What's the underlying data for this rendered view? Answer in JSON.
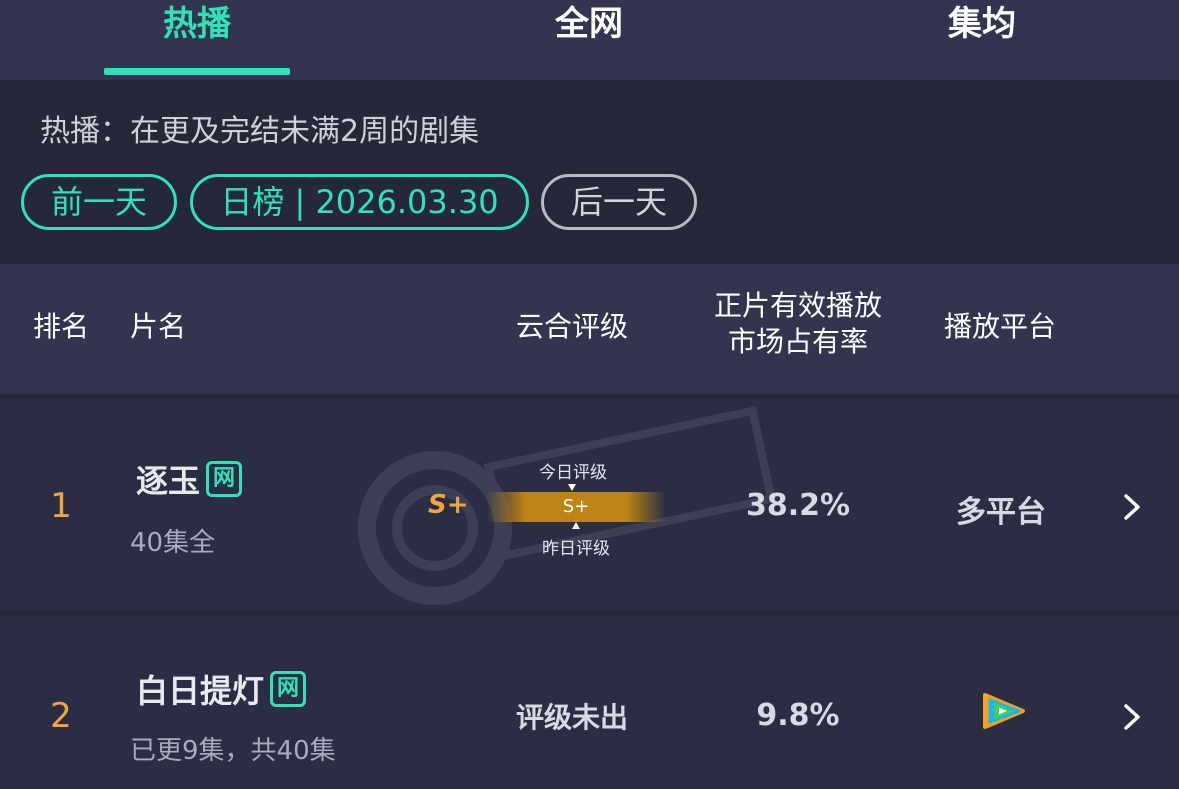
{
  "tabs": [
    {
      "label": "热播",
      "active": true
    },
    {
      "label": "全网",
      "active": false
    },
    {
      "label": "集均",
      "active": false
    }
  ],
  "info": {
    "description": "热播：在更及完结未满2周的剧集",
    "prev_label": "前一天",
    "date_label": "日榜 | 2026.03.30",
    "next_label": "后一天"
  },
  "table_headers": {
    "rank": "排名",
    "title": "片名",
    "rating": "云合评级",
    "share_line1": "正片有效播放",
    "share_line2": "市场占有率",
    "platform": "播放平台"
  },
  "rows": [
    {
      "rank": "1",
      "title": "逐玉",
      "badge": "网",
      "episodes": "40集全",
      "rating_today_label": "今日评级",
      "rating_yesterday_label": "昨日评级",
      "rating_today": "S+",
      "rating_bar_value": "S+",
      "share": "38.2%",
      "platform": "多平台",
      "chevron_icon": "chevron-right-icon"
    },
    {
      "rank": "2",
      "title": "白日提灯",
      "badge": "网",
      "episodes": "已更9集，共40集",
      "rating_text": "评级未出",
      "share": "9.8%",
      "platform_icon": "tencent-video-icon",
      "chevron_icon": "chevron-right-icon"
    }
  ],
  "colors": {
    "accent": "#2fe3b7",
    "rank": "#f2a640",
    "background": "#252838",
    "header_bg": "#323450"
  }
}
